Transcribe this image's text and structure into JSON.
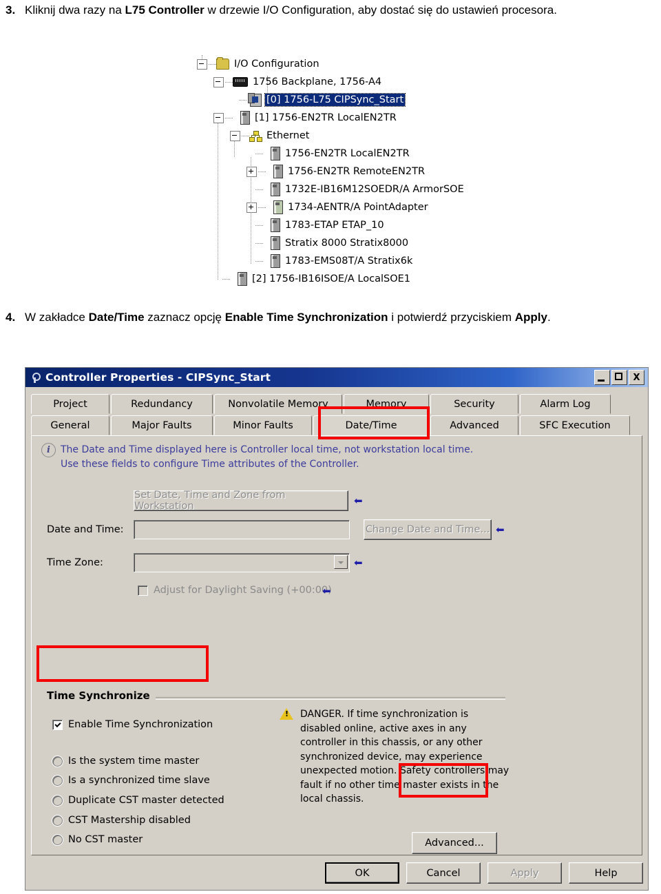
{
  "steps": [
    {
      "number": "3.",
      "parts": [
        {
          "t": "Kliknij dwa razy na ",
          "b": false
        },
        {
          "t": "L75 Controller",
          "b": true
        },
        {
          "t": " w drzewie I/O Configuration, aby dostać się do ustawień procesora.",
          "b": false
        }
      ]
    },
    {
      "number": "4.",
      "parts": [
        {
          "t": "W zakładce ",
          "b": false
        },
        {
          "t": "Date/Time",
          "b": true
        },
        {
          "t": " zaznacz opcję ",
          "b": false
        },
        {
          "t": "Enable Time Synchronization",
          "b": true
        },
        {
          "t": " i potwierdź przyciskiem ",
          "b": false
        },
        {
          "t": "Apply",
          "b": true
        },
        {
          "t": ".",
          "b": false
        }
      ]
    }
  ],
  "tree": {
    "nodes": [
      {
        "label": "I/O Configuration",
        "icon": "folder-icon",
        "indent": 0,
        "expander": "minus",
        "selected": false
      },
      {
        "label": "1756 Backplane, 1756-A4",
        "icon": "backplane-icon",
        "indent": 1,
        "expander": "minus",
        "selected": false
      },
      {
        "label": "[0] 1756-L75 CIPSync_Start",
        "icon": "controller-icon",
        "indent": 2,
        "expander": "none",
        "selected": true
      },
      {
        "label": "[1] 1756-EN2TR LocalEN2TR",
        "icon": "module-icon",
        "indent": 2,
        "expander": "minus",
        "selected": false
      },
      {
        "label": "Ethernet",
        "icon": "ethernet-icon",
        "indent": 3,
        "expander": "minus",
        "selected": false
      },
      {
        "label": "1756-EN2TR LocalEN2TR",
        "icon": "module-icon",
        "indent": 4,
        "expander": "none",
        "selected": false
      },
      {
        "label": "1756-EN2TR RemoteEN2TR",
        "icon": "module-icon",
        "indent": 4,
        "expander": "plus",
        "selected": false
      },
      {
        "label": "1732E-IB16M12SOEDR/A ArmorSOE",
        "icon": "module-icon",
        "indent": 4,
        "expander": "none",
        "selected": false
      },
      {
        "label": "1734-AENTR/A PointAdapter",
        "icon": "module-green-icon",
        "indent": 4,
        "expander": "plus",
        "selected": false
      },
      {
        "label": "1783-ETAP ETAP_10",
        "icon": "module-icon",
        "indent": 4,
        "expander": "none",
        "selected": false
      },
      {
        "label": "Stratix 8000 Stratix8000",
        "icon": "module-icon",
        "indent": 4,
        "expander": "none",
        "selected": false
      },
      {
        "label": "1783-EMS08T/A Stratix6k",
        "icon": "module-icon",
        "indent": 4,
        "expander": "none",
        "selected": false
      },
      {
        "label": "[2] 1756-IB16ISOE/A LocalSOE1",
        "icon": "module-icon",
        "indent": 2,
        "expander": "none",
        "selected": false
      }
    ]
  },
  "dialog": {
    "title": "Controller Properties - CIPSync_Start",
    "window_buttons": {
      "minimize": "_",
      "maximize": "□",
      "close": "X"
    },
    "tabs_row1": [
      "Project",
      "Redundancy",
      "Nonvolatile Memory",
      "Memory",
      "Security",
      "Alarm Log"
    ],
    "tabs_row2": [
      "General",
      "Major Faults",
      "Minor Faults",
      "Date/Time",
      "Advanced",
      "SFC Execution"
    ],
    "active_tab": "Date/Time",
    "info_lines": [
      "The Date and Time displayed here is Controller local time, not workstation local time.",
      "Use these fields to configure Time attributes of the Controller."
    ],
    "set_from_workstation_label": "Set Date, Time and Zone from Workstation",
    "date_time_label": "Date and Time:",
    "date_time_value": "",
    "change_date_time_label": "Change Date and Time...",
    "time_zone_label": "Time Zone:",
    "time_zone_value": "",
    "daylight_label": "Adjust for Daylight Saving (+00:00)",
    "group_title": "Time Synchronize",
    "enable_sync_label": "Enable Time Synchronization",
    "enable_sync_checked": true,
    "radios": [
      "Is the system time master",
      "Is a synchronized time slave",
      "Duplicate CST master detected",
      "CST Mastership disabled",
      "No CST master"
    ],
    "danger_lines": [
      "DANGER. If time synchronization is",
      "disabled online, active axes in any",
      "controller in this chassis, or any other",
      "synchronized device, may experience",
      "unexpected motion.  Safety controllers may",
      "fault if no other time master exists in the",
      "local chassis."
    ],
    "advanced_label": "Advanced...",
    "buttons": [
      "OK",
      "Cancel",
      "Apply",
      "Help"
    ],
    "disabled_buttons": [
      "Apply"
    ],
    "highlight_color": "#f40000"
  }
}
